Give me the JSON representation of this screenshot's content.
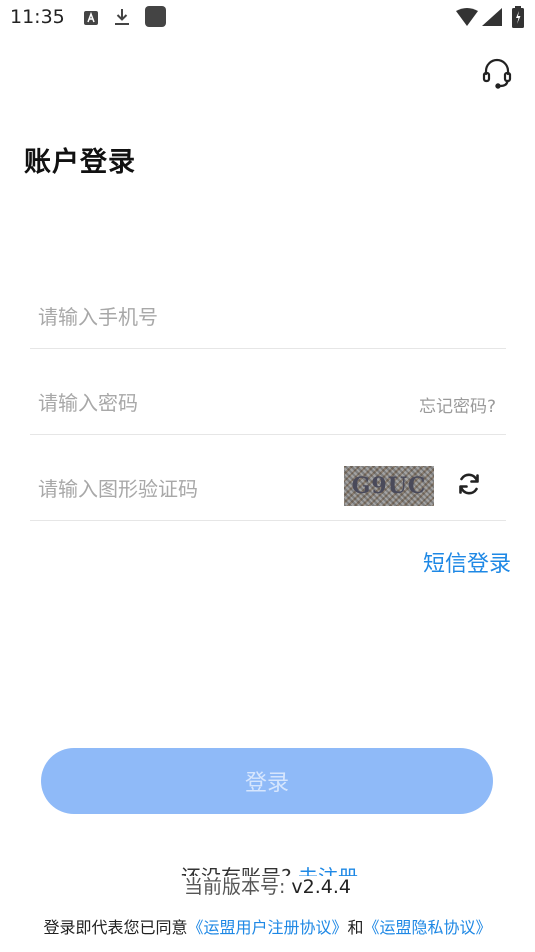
{
  "status_bar": {
    "time": "11:35",
    "icons": [
      "a-notification-icon",
      "download-icon",
      "app-square-icon",
      "wifi-icon",
      "signal-icon",
      "battery-icon"
    ]
  },
  "header": {
    "support_icon": "headset-icon"
  },
  "page": {
    "title": "账户登录"
  },
  "form": {
    "phone_placeholder": "请输入手机号",
    "password_placeholder": "请输入密码",
    "forgot_password": "忘记密码?",
    "captcha_placeholder": "请输入图形验证码",
    "captcha_text": "G9UC",
    "sms_login": "短信登录",
    "login_button": "登录"
  },
  "footer": {
    "no_account_text": "还没有账号?",
    "register_link": "去注册",
    "version_label": "当前版本号:",
    "version_value": "v2.4.4",
    "agreement_prefix": "登录即代表您已同意",
    "user_agreement": "《运盟用户注册协议》",
    "agreement_and": "和",
    "privacy_agreement": "《运盟隐私协议》"
  },
  "colors": {
    "accent": "#1e88e5",
    "login_button_bg": "#8fbaf8",
    "login_button_text": "#d7e6fd",
    "placeholder": "#a8a8a8",
    "divider": "#e6e6e6"
  }
}
